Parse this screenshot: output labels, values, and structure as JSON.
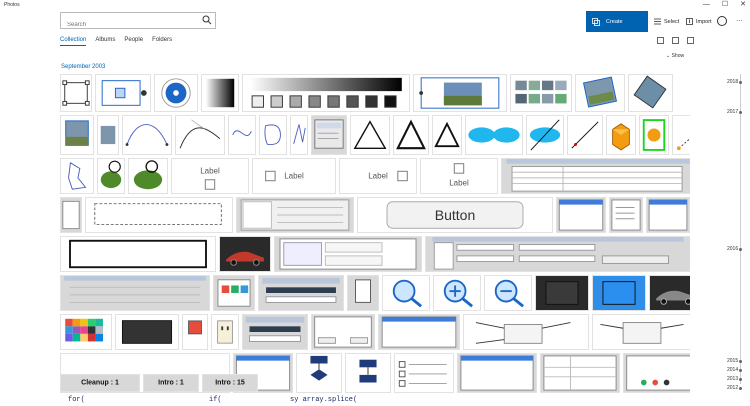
{
  "app": {
    "title": "Photos",
    "accent": "#0063b1"
  },
  "window_controls": [
    "—",
    "☐",
    "✕"
  ],
  "search": {
    "placeholder": "Search",
    "value": ""
  },
  "toolbar": {
    "create_label": "Create",
    "select_label": "Select",
    "import_label": "Import",
    "more_label": "…"
  },
  "nav": {
    "tabs": [
      {
        "label": "Collection",
        "active": true
      },
      {
        "label": "Albums"
      },
      {
        "label": "People"
      },
      {
        "label": "Folders"
      }
    ]
  },
  "view_icons": [
    "grid-large-icon",
    "grid-medium-icon",
    "grid-small-icon"
  ],
  "filter": {
    "show_label": "Show"
  },
  "section": {
    "date_label": "September 2003"
  },
  "thumbnails": {
    "label_1": "Label",
    "label_2": "Label",
    "label_3": "Label",
    "label_4": "Label",
    "button": "Button",
    "cleanup": "Cleanup : 1",
    "intro_1": "Intro : 1",
    "intro_15": "Intro : 15",
    "code_1": "for(",
    "code_2": "if(",
    "code_3": "sy array.splice("
  },
  "timeline": {
    "years": [
      "2018",
      "2017",
      "2016",
      "2015",
      "2014",
      "2013",
      "2012"
    ]
  }
}
